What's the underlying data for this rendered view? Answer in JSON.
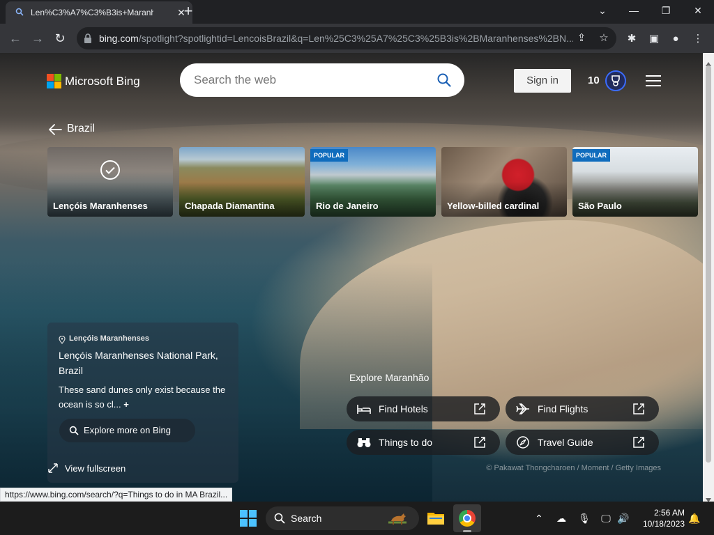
{
  "browser": {
    "tab_title": "Len%C3%A7%C3%B3is+Maranh",
    "url_host": "bing.com",
    "url_path": "/spotlight?spotlightid=LencoisBrazil&q=Len%25C3%25A7%25C3%25B3is%2BMaranhenses%2BN...",
    "status_url": "https://www.bing.com/search/?q=Things to do in MA Brazil..."
  },
  "header": {
    "logo_text": "Microsoft Bing",
    "search_placeholder": "Search the web",
    "signin_label": "Sign in",
    "rewards_points": "10"
  },
  "breadcrumb": {
    "label": "Brazil"
  },
  "cards": [
    {
      "label": "Lençóis Maranhenses",
      "selected": true,
      "badge": ""
    },
    {
      "label": "Chapada Diamantina",
      "selected": false,
      "badge": ""
    },
    {
      "label": "Rio de Janeiro",
      "selected": false,
      "badge": "POPULAR"
    },
    {
      "label": "Yellow-billed cardinal",
      "selected": false,
      "badge": ""
    },
    {
      "label": "São Paulo",
      "selected": false,
      "badge": "POPULAR"
    }
  ],
  "info": {
    "location": "Lençóis Maranhenses",
    "headline": "Lençóis Maranhenses National Park, Brazil",
    "description": "These sand dunes only exist because the ocean is so cl...",
    "explore_label": "Explore more on Bing",
    "fullscreen_label": "View fullscreen"
  },
  "explore": {
    "title": "Explore Maranhão",
    "items": [
      {
        "label": "Find Hotels",
        "icon": "bed-icon"
      },
      {
        "label": "Find Flights",
        "icon": "plane-icon"
      },
      {
        "label": "Things to do",
        "icon": "binoculars-icon"
      },
      {
        "label": "Travel Guide",
        "icon": "compass-icon"
      }
    ]
  },
  "credit": "© Pakawat Thongcharoen / Moment / Getty Images",
  "taskbar": {
    "search_label": "Search",
    "time": "2:56 AM",
    "date": "10/18/2023"
  },
  "colors": {
    "accent_blue": "#0f6cbd",
    "chrome_dark": "#202124",
    "chrome_toolbar": "#35363a"
  }
}
